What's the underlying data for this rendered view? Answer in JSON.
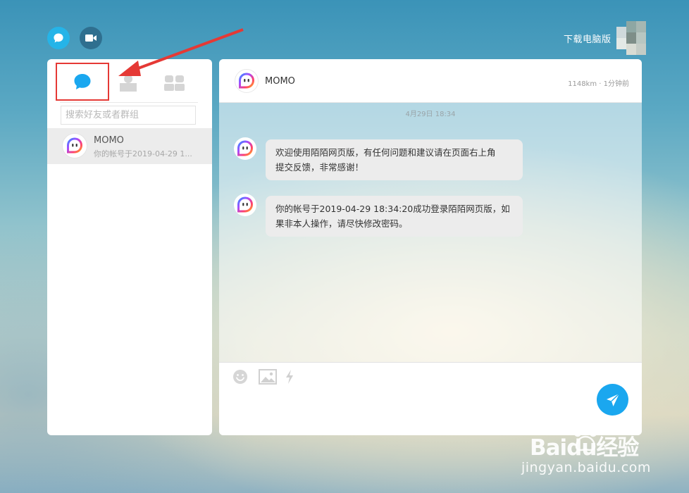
{
  "topbar": {
    "download_label": "下载电脑版",
    "chat_icon": "chat-bubble-icon",
    "video_icon": "video-camera-icon"
  },
  "sidebar": {
    "tabs": [
      {
        "icon": "chat-bubble-icon",
        "active": true
      },
      {
        "icon": "contact-card-icon",
        "active": false
      },
      {
        "icon": "group-icon",
        "active": false
      }
    ],
    "search_placeholder": "搜索好友或者群组",
    "conversations": [
      {
        "name": "MOMO",
        "preview": "你的帐号于2019-04-29 1...",
        "avatar": "momo-logo"
      }
    ]
  },
  "chat": {
    "contact_name": "MOMO",
    "meta": "1148km · 1分钟前",
    "date_separator": "4月29日 18:34",
    "messages": [
      {
        "sender": "MOMO",
        "text_lines": [
          "欢迎使用陌陌网页版，有任何问题和建议请在页面右上角",
          "提交反馈，非常感谢！"
        ]
      },
      {
        "sender": "MOMO",
        "text_lines": [
          "你的帐号于2019-04-29 18:34:20成功登录陌陌网页版，如",
          "果非本人操作，请尽快修改密码。"
        ]
      }
    ],
    "composer_tools": [
      "emoji-icon",
      "image-icon",
      "lightning-icon"
    ],
    "send_icon": "paper-plane-icon"
  },
  "annotation": {
    "highlight_color": "#e53935"
  },
  "colors": {
    "accent": "#1aa7ef",
    "chat_tab_active": "#1aa7ef",
    "video_button": "#2f6f8f",
    "bubble_bg": "#ececec"
  },
  "watermark": {
    "brand": "Baidu经验",
    "url": "jingyan.baidu.com"
  }
}
